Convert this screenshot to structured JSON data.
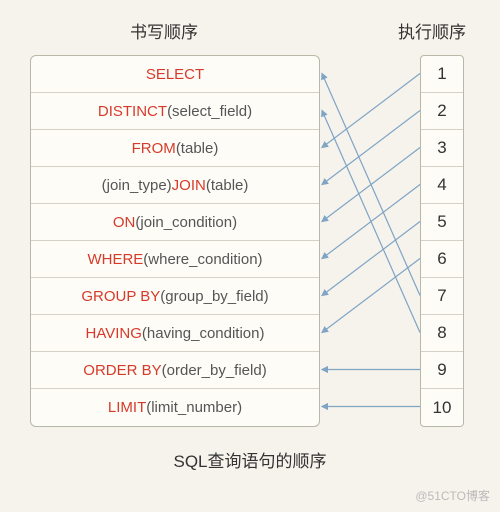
{
  "headers": {
    "left": "书写顺序",
    "right": "执行顺序"
  },
  "caption": "SQL查询语句的顺序",
  "watermark": "@51CTO博客",
  "left_items": [
    {
      "kw": "SELECT",
      "rest": ""
    },
    {
      "kw": "DISTINCT",
      "rest": " (select_field)"
    },
    {
      "kw": "FROM",
      "rest": " (table)"
    },
    {
      "pre": "(join_type) ",
      "kw": "JOIN",
      "rest": " (table)"
    },
    {
      "kw": "ON",
      "rest": " (join_condition)"
    },
    {
      "kw": "WHERE",
      "rest": " (where_condition)"
    },
    {
      "kw": "GROUP BY",
      "rest": " (group_by_field)"
    },
    {
      "kw": "HAVING",
      "rest": " (having_condition)"
    },
    {
      "kw": "ORDER BY",
      "rest": " (order_by_field)"
    },
    {
      "kw": "LIMIT",
      "rest": " (limit_number)"
    }
  ],
  "right_items": [
    "1",
    "2",
    "3",
    "4",
    "5",
    "6",
    "7",
    "8",
    "9",
    "10"
  ],
  "mapping": [
    {
      "exec": 1,
      "write": "FROM"
    },
    {
      "exec": 2,
      "write": "JOIN"
    },
    {
      "exec": 3,
      "write": "ON"
    },
    {
      "exec": 4,
      "write": "WHERE"
    },
    {
      "exec": 5,
      "write": "GROUP BY"
    },
    {
      "exec": 6,
      "write": "HAVING"
    },
    {
      "exec": 7,
      "write": "SELECT"
    },
    {
      "exec": 8,
      "write": "DISTINCT"
    },
    {
      "exec": 9,
      "write": "ORDER BY"
    },
    {
      "exec": 10,
      "write": "LIMIT"
    }
  ],
  "chart_data": {
    "type": "table",
    "title": "SQL查询语句的顺序",
    "columns": [
      "书写顺序",
      "执行顺序"
    ],
    "rows": [
      [
        "SELECT",
        7
      ],
      [
        "DISTINCT (select_field)",
        8
      ],
      [
        "FROM (table)",
        1
      ],
      [
        "(join_type) JOIN (table)",
        2
      ],
      [
        "ON (join_condition)",
        3
      ],
      [
        "WHERE (where_condition)",
        4
      ],
      [
        "GROUP BY (group_by_field)",
        5
      ],
      [
        "HAVING (having_condition)",
        6
      ],
      [
        "ORDER BY (order_by_field)",
        9
      ],
      [
        "LIMIT (limit_number)",
        10
      ]
    ]
  }
}
